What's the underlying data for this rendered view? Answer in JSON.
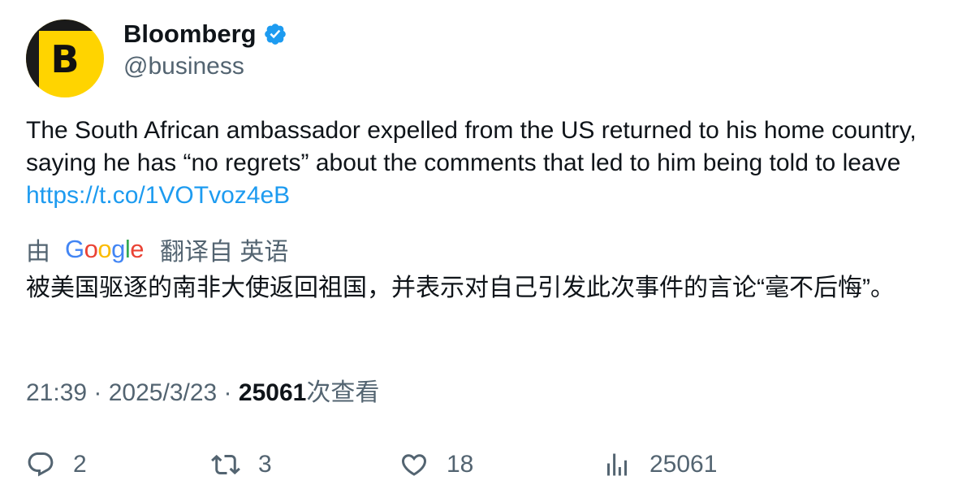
{
  "author": {
    "avatar_letter": "B",
    "display_name": "Bloomberg",
    "handle": "@business",
    "verified_icon": "verified-badge",
    "colors": {
      "avatar_bg": "#ffd400",
      "verified": "#1d9bf0"
    }
  },
  "tweet": {
    "text": "The South African ambassador expelled from the US returned to his home country, saying he has “no regrets” about the comments that led to him being told to leave ",
    "link": "https://t.co/1VOTvoz4eB",
    "link_color": "#1d9bf0"
  },
  "translation": {
    "prefix": "由",
    "provider_letters": [
      "G",
      "o",
      "o",
      "g",
      "l",
      "e"
    ],
    "suffix": "翻译自 英语",
    "text": "被美国驱逐的南非大使返回祖国，并表示对自己引发此次事件的言论“毫不后悔”。"
  },
  "meta": {
    "time": "21:39",
    "separator": " · ",
    "date": "2025/3/23",
    "views_count": "25061",
    "views_label": "次查看"
  },
  "actions": {
    "reply": {
      "icon": "reply-icon",
      "count": "2"
    },
    "retweet": {
      "icon": "retweet-icon",
      "count": "3"
    },
    "like": {
      "icon": "heart-icon",
      "count": "18"
    },
    "views": {
      "icon": "analytics-icon",
      "count": "25061"
    }
  }
}
